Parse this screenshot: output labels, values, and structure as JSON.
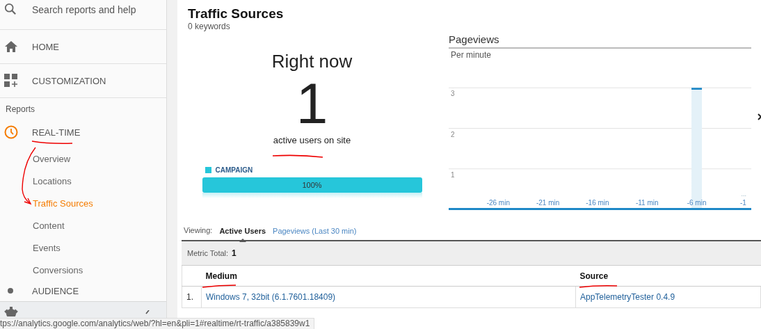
{
  "sidebar": {
    "search": {
      "placeholder": "Search reports and help"
    },
    "nav": [
      {
        "label": "HOME",
        "kind": "home"
      },
      {
        "label": "CUSTOMIZATION",
        "kind": "grid"
      }
    ],
    "section_label": "Reports",
    "realtime": {
      "label": "REAL-TIME",
      "expanded": true,
      "children": [
        {
          "label": "Overview",
          "selected": false
        },
        {
          "label": "Locations",
          "selected": false
        },
        {
          "label": "Traffic Sources",
          "selected": true
        },
        {
          "label": "Content",
          "selected": false
        },
        {
          "label": "Events",
          "selected": false
        },
        {
          "label": "Conversions",
          "selected": false
        }
      ]
    },
    "next_section": {
      "label": "AUDIENCE"
    }
  },
  "header": {
    "title": "Traffic Sources",
    "subtitle": "0 keywords"
  },
  "summary": {
    "heading": "Right now",
    "count": "1",
    "caption": "active users on site",
    "segments": [
      {
        "label": "CAMPAIGN",
        "color": "#26c6da",
        "level": 1,
        "reading": "100%"
      }
    ]
  },
  "pageviews": {
    "title": "Pageviews",
    "chart_data": {
      "type": "bar",
      "title": "Per minute",
      "x": [
        -6
      ],
      "values": [
        3
      ],
      "grid": true,
      "xlim": [
        -31,
        -0.5
      ],
      "ylim": [
        0,
        4
      ],
      "xticks": [
        {
          "value": -26,
          "label": "-26 min"
        },
        {
          "value": -21,
          "label": "-21 min"
        },
        {
          "value": -16,
          "label": "-16 min"
        },
        {
          "value": -11,
          "label": "-11 min"
        },
        {
          "value": -6,
          "label": "-6 min"
        },
        {
          "value": -1,
          "label": "-1"
        }
      ],
      "yticks": [
        1,
        2,
        3
      ]
    },
    "more_marker": "..."
  },
  "viewing": {
    "label": "Viewing:",
    "tabs": [
      {
        "label": "Active Users",
        "selected": true
      },
      {
        "label": "Pageviews (Last 30 min)",
        "selected": false
      }
    ]
  },
  "table": {
    "metric_label": "Metric Total:",
    "metric_value": "1",
    "columns": [
      "Medium",
      "Source"
    ],
    "rows": [
      {
        "index": "1.",
        "cells": [
          "Windows 7, 32bit (6.1.7601.18409)",
          "AppTelemetryTester 0.4.9"
        ]
      }
    ]
  },
  "status_bar": {
    "url": "tps://analytics.google.com/analytics/web/?hl=en&pli=1#realtime/rt-traffic/a385839w1"
  }
}
